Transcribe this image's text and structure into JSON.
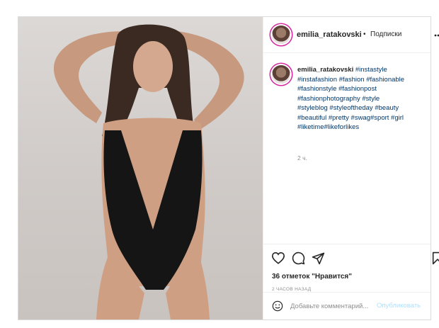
{
  "post": {
    "username": "emilia_ratakovski",
    "separator": "•",
    "follow_label": "Подписки",
    "caption": {
      "username": "emilia_ratakovski",
      "hashtags": [
        "#instastyle",
        "#instafashion",
        "#fashion",
        "#fashionable",
        "#fashionstyle",
        "#fashionpost",
        "#fashionphotography",
        "#style",
        "#styleblog",
        "#styleoftheday",
        "#beauty",
        "#beautiful",
        "#pretty",
        "#swag",
        "#sport",
        "#girl",
        "#liketime",
        "#likeforlikes"
      ]
    },
    "caption_time": "2 ч.",
    "likes_text": "36 отметок \"Нравится\"",
    "post_date": "2 ЧАСОВ НАЗАД",
    "comment_placeholder": "Добавьте комментарий...",
    "publish_label": "Опубликовать",
    "icons": {
      "more": "more-options-icon",
      "like": "heart-icon",
      "comment": "comment-icon",
      "share": "paper-plane-icon",
      "save": "bookmark-icon",
      "emoji": "smiley-icon"
    },
    "colors": {
      "link": "#00376b",
      "muted": "#8e8e8e",
      "publish_disabled": "#b2dffc",
      "story_ring": "#d6249f"
    }
  }
}
